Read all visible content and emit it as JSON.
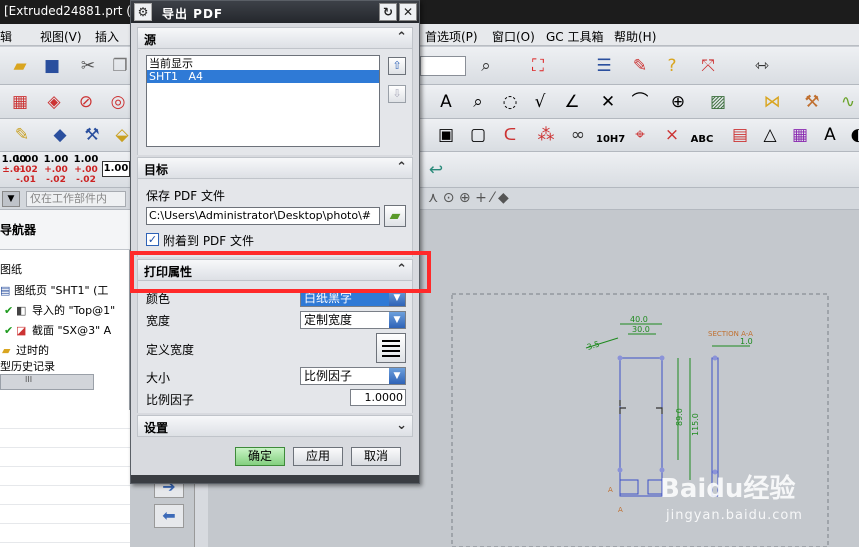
{
  "app": {
    "title": "[Extruded24881.prt (",
    "menu": [
      "辑",
      "视图(V)",
      "插入",
      "首选项(P)",
      "窗口(O)",
      "GC 工具箱",
      "帮助(H)"
    ],
    "snap_placeholder": "仅在工作部件内",
    "dim_buttons": [
      {
        "value": "1.00",
        "tol": "±.01"
      },
      {
        "value": "1.00",
        "tol": "+.02\n-.01"
      },
      {
        "value": "1.00",
        "tol": "+.00\n-.02"
      },
      {
        "value": "1.00",
        "tol": "+.00\n-.02"
      },
      {
        "value": "1.00",
        "tol": ""
      }
    ],
    "tol_label": "10H7",
    "abc_label": "ABC"
  },
  "navigator": {
    "title": "导航器",
    "items": [
      {
        "label": "图纸"
      },
      {
        "label": "图纸页 \"SHT1\" (工"
      },
      {
        "label": "导入的 \"Top@1\""
      },
      {
        "label": "截面 \"SX@3\" A"
      },
      {
        "label": "过时的"
      },
      {
        "label": "型历史记录"
      }
    ],
    "scroll_glyph": "III"
  },
  "dialog": {
    "title": "导出 PDF",
    "title_buttons": {
      "reset": "↻",
      "close": "✕"
    },
    "sections": {
      "source": "源",
      "target": "目标",
      "print": "打印属性",
      "settings": "设置"
    },
    "source_list": [
      "当前显示",
      "SHT1   A4"
    ],
    "save_label": "保存 PDF 文件",
    "save_path": "C:\\Users\\Administrator\\Desktop\\photo\\#",
    "append_label": "附着到 PDF 文件",
    "append_checked": true,
    "color_label": "颜色",
    "color_value": "白纸黑字",
    "width_label": "宽度",
    "width_value": "定制宽度",
    "custom_width_label": "定义宽度",
    "size_label": "大小",
    "size_value": "比例因子",
    "scale_label": "比例因子",
    "scale_value": "1.0000",
    "ok": "确定",
    "apply": "应用",
    "cancel": "取消"
  },
  "drawing": {
    "section_label": "SECTION A-A",
    "dims": [
      "40.0",
      "30.0",
      "3.5",
      "89.0",
      "115.0",
      "1.0"
    ],
    "view_labels": [
      "A",
      "A"
    ]
  },
  "watermark": {
    "brand": "Baidu经验",
    "url": "jingyan.baidu.com"
  },
  "colors": {
    "highlight": "#ff2a2a",
    "dialog_title": "#2b2e33",
    "selection": "#2f7ad6",
    "ok_button": "#84d07f"
  }
}
